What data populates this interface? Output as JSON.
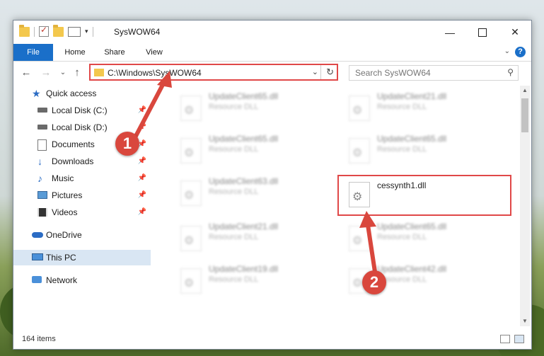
{
  "window": {
    "title": "SysWOW64"
  },
  "ribbon": {
    "tabs": [
      "File",
      "Home",
      "Share",
      "View"
    ],
    "help_icon": "help-icon"
  },
  "navigation": {
    "back_icon": "back-arrow-icon",
    "forward_icon": "forward-arrow-icon",
    "recent_icon": "chevron-down-icon",
    "up_icon": "up-arrow-icon",
    "address": "C:\\Windows\\SysWOW64",
    "search_placeholder": "Search SysWOW64"
  },
  "sidebar": {
    "items": [
      {
        "label": "Quick access",
        "icon": "star-icon",
        "pinned": false
      },
      {
        "label": "Local Disk (C:)",
        "icon": "drive-icon",
        "pinned": true
      },
      {
        "label": "Local Disk (D:)",
        "icon": "drive-icon",
        "pinned": true
      },
      {
        "label": "Documents",
        "icon": "documents-icon",
        "pinned": true
      },
      {
        "label": "Downloads",
        "icon": "downloads-icon",
        "pinned": true
      },
      {
        "label": "Music",
        "icon": "music-icon",
        "pinned": true
      },
      {
        "label": "Pictures",
        "icon": "pictures-icon",
        "pinned": true
      },
      {
        "label": "Videos",
        "icon": "videos-icon",
        "pinned": true
      },
      {
        "label": "OneDrive",
        "icon": "cloud-icon",
        "pinned": false
      },
      {
        "label": "This PC",
        "icon": "computer-icon",
        "pinned": false,
        "selected": true
      },
      {
        "label": "Network",
        "icon": "network-icon",
        "pinned": false
      }
    ]
  },
  "files": [
    {
      "name": "UpdateClient65.dll",
      "type": "Resource DLL",
      "blurred": true
    },
    {
      "name": "UpdateClient21.dll",
      "type": "Resource DLL",
      "blurred": true
    },
    {
      "name": "UpdateClient65.dll",
      "type": "Resource DLL",
      "blurred": true
    },
    {
      "name": "UpdateClient65.dll",
      "type": "Resource DLL",
      "blurred": true
    },
    {
      "name": "UpdateClient63.dll",
      "type": "Resource DLL",
      "blurred": true
    },
    {
      "name": "cessynth1.dll",
      "type": "",
      "blurred": false,
      "highlighted": true
    },
    {
      "name": "UpdateClient21.dll",
      "type": "Resource DLL",
      "blurred": true
    },
    {
      "name": "UpdateClient65.dll",
      "type": "Resource DLL",
      "blurred": true
    },
    {
      "name": "UpdateClient19.dll",
      "type": "Resource DLL",
      "blurred": true
    },
    {
      "name": "UpdateClient42.dll",
      "type": "Resource DLL",
      "blurred": true
    }
  ],
  "status": {
    "item_count": "164 items"
  },
  "annotations": {
    "step1": "1",
    "step2": "2",
    "color": "#d9473d"
  }
}
